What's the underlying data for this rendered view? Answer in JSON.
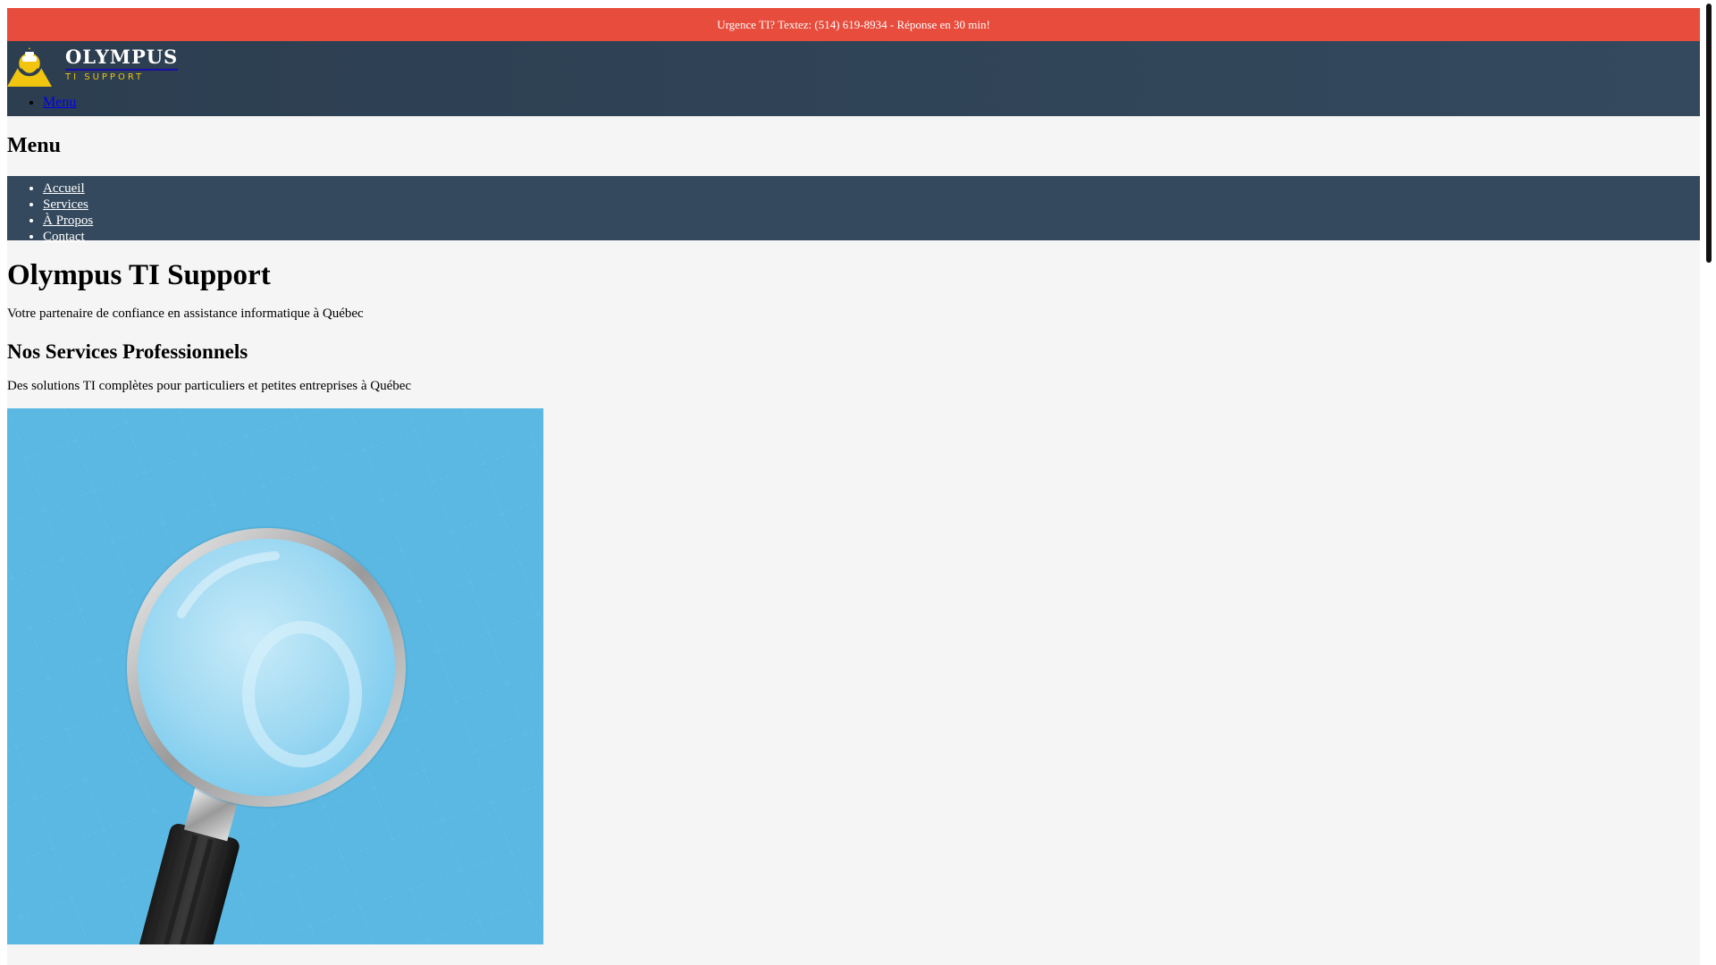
{
  "alert": {
    "text": "Urgence TI? Textez: (514) 619-8934 - Réponse en 30 min!"
  },
  "header": {
    "logo_name": "OLYMPUS",
    "logo_tagline": "TI SUPPORT",
    "menu_toggle": "Menu"
  },
  "menu": {
    "heading": "Menu",
    "items": [
      {
        "label": "Accueil"
      },
      {
        "label": "Services"
      },
      {
        "label": "À Propos"
      },
      {
        "label": "Contact"
      }
    ]
  },
  "hero": {
    "title": "Olympus TI Support",
    "subtitle": "Votre partenaire de confiance en assistance informatique à Québec"
  },
  "services": {
    "title": "Nos Services Professionnels",
    "subtitle": "Des solutions TI complètes pour particuliers et petites entreprises à Québec",
    "image_icon": "magnifying-glass-image"
  },
  "colors": {
    "alert_bg": "#e74c3c",
    "header_bg": "#2c3e50",
    "nav_bg": "#34495e",
    "accent_yellow": "#f1c40f",
    "image_bg": "#5ab8e3"
  }
}
